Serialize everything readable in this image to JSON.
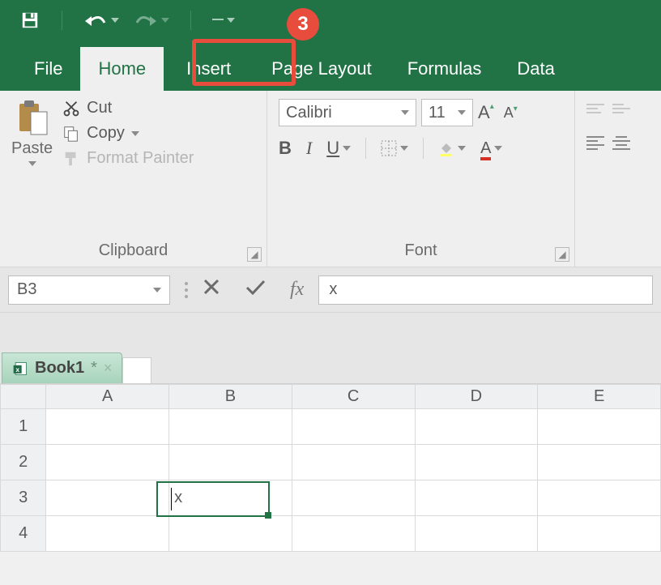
{
  "qat": {
    "save": "save",
    "undo": "undo",
    "redo": "redo"
  },
  "tabs": {
    "file": "File",
    "home": "Home",
    "insert": "Insert",
    "page": "Page Layout",
    "formulas": "Formulas",
    "data": "Data"
  },
  "annotation": {
    "badge": "3"
  },
  "ribbon": {
    "clipboard": {
      "paste": "Paste",
      "cut": "Cut",
      "copy": "Copy",
      "format_painter": "Format Painter",
      "group_label": "Clipboard"
    },
    "font": {
      "name": "Calibri",
      "size": "11",
      "bold": "B",
      "italic": "I",
      "underline": "U",
      "group_label": "Font"
    }
  },
  "formula_bar": {
    "name_box": "B3",
    "fx_label": "fx",
    "value": "x"
  },
  "workbook": {
    "tab_name": "Book1",
    "modified": "*"
  },
  "grid": {
    "columns": [
      "A",
      "B",
      "C",
      "D",
      "E"
    ],
    "rows": [
      "1",
      "2",
      "3",
      "4"
    ],
    "active_cell": {
      "col": "B",
      "row": "3",
      "value": "x"
    }
  }
}
